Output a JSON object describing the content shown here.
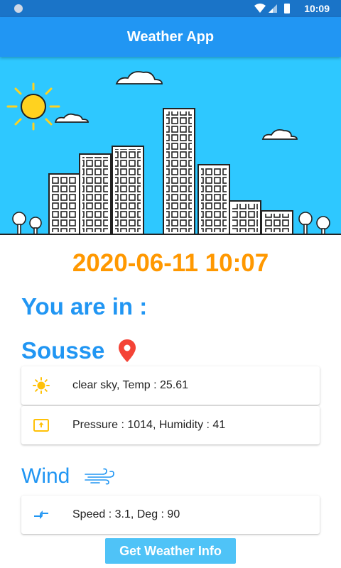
{
  "status_bar": {
    "time": "10:09"
  },
  "app_bar": {
    "title": "Weather App"
  },
  "datetime": "2020-06-11 10:07",
  "location": {
    "heading": "You are in :",
    "city": "Sousse"
  },
  "weather": {
    "icon": "sun-icon",
    "text": "clear sky, Temp : 25.61"
  },
  "atmosphere": {
    "icon": "pressure-icon",
    "text": "Pressure : 1014, Humidity : 41"
  },
  "wind": {
    "title": "Wind",
    "icon": "wind-icon",
    "speed_icon": "arrows-compress-icon",
    "text": "Speed : 3.1, Deg : 90"
  },
  "action": {
    "label": "Get Weather Info"
  },
  "colors": {
    "primary": "#2196f3",
    "status_bar": "#1a74c8",
    "accent": "#ff9800",
    "sky": "#2ec8ff",
    "button": "#4fc3f7",
    "pin": "#f44336"
  }
}
